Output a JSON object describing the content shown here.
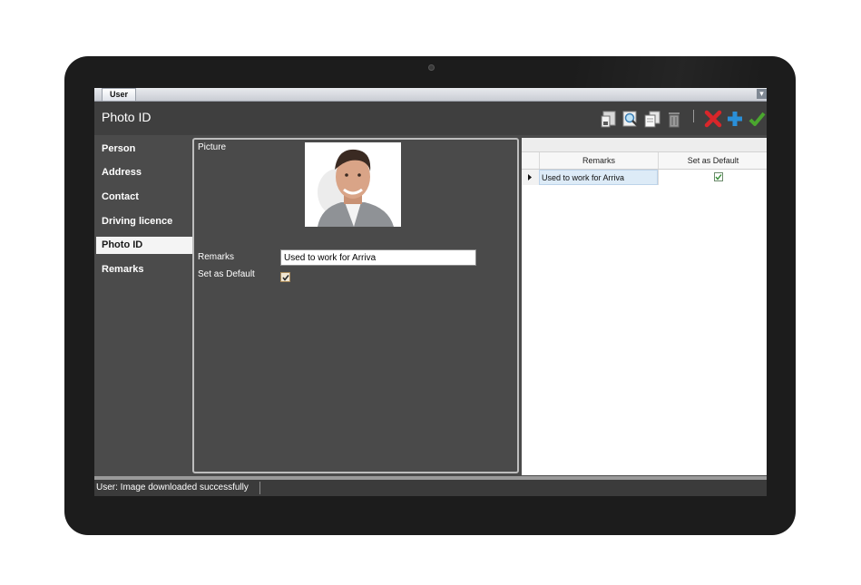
{
  "window": {
    "tab_label": "User"
  },
  "header": {
    "title": "Photo ID"
  },
  "toolbar": {
    "buttons": [
      {
        "icon": "save-icon"
      },
      {
        "icon": "search-icon"
      },
      {
        "icon": "copy-icon"
      },
      {
        "icon": "delete-icon"
      },
      {
        "icon": "cancel-icon"
      },
      {
        "icon": "add-icon"
      },
      {
        "icon": "confirm-icon"
      }
    ]
  },
  "sidebar": {
    "items": [
      {
        "label": "Person",
        "active": false
      },
      {
        "label": "Address",
        "active": false
      },
      {
        "label": "Contact",
        "active": false
      },
      {
        "label": "Driving licence",
        "active": false
      },
      {
        "label": "Photo ID",
        "active": true
      },
      {
        "label": "Remarks",
        "active": false
      }
    ]
  },
  "form": {
    "picture_label": "Picture",
    "remarks_label": "Remarks",
    "remarks_value": "Used to work for Arriva",
    "default_label": "Set as Default",
    "default_checked": true
  },
  "grid": {
    "columns": [
      "Remarks",
      "Set as Default"
    ],
    "rows": [
      {
        "remarks": "Used to work for Arriva",
        "is_default": true
      }
    ]
  },
  "status": {
    "text": "User: Image downloaded successfully"
  },
  "colors": {
    "accent_red": "#d9262a",
    "accent_blue": "#2a8fd8",
    "accent_green": "#4aa62e"
  }
}
